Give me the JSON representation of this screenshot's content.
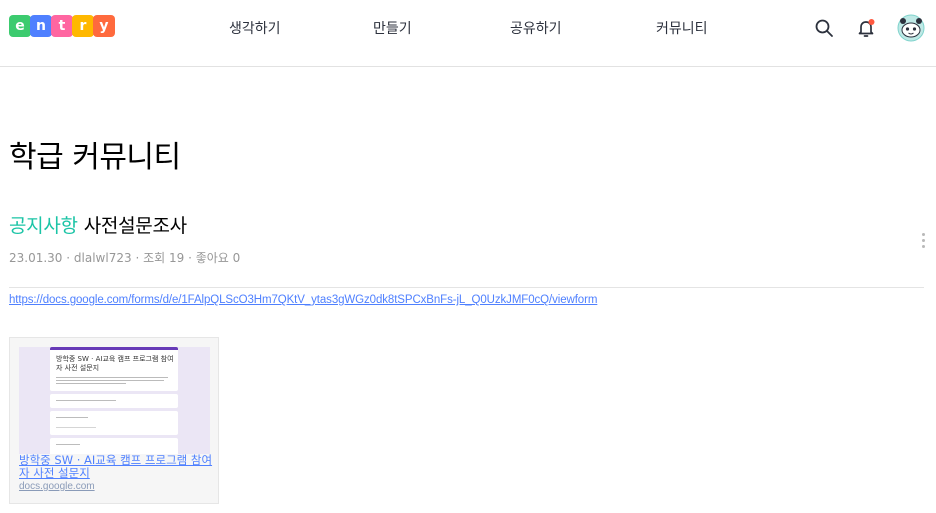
{
  "header": {
    "logo_letters": [
      {
        "char": "e",
        "color": "#3ccb6f"
      },
      {
        "char": "n",
        "color": "#4f80ff"
      },
      {
        "char": "t",
        "color": "#ff66a1"
      },
      {
        "char": "r",
        "color": "#ffb800"
      },
      {
        "char": "y",
        "color": "#ff6a3d"
      }
    ],
    "nav": [
      "생각하기",
      "만들기",
      "공유하기",
      "커뮤니티"
    ],
    "icons": [
      "search-icon",
      "bell-icon",
      "avatar"
    ],
    "notification_dot_color": "#ff5940"
  },
  "page": {
    "title": "학급 커뮤니티"
  },
  "post": {
    "category": "공지사항",
    "title": "사전설문조사",
    "date": "23.01.30",
    "author": "dlalwl723",
    "views": "조회 19",
    "likes": "좋아요 0",
    "link_url": "https://docs.google.com/forms/d/e/1FAlpQLScO3Hm7QKtV_ytas3gWGz0dk8tSPCxBnFs-jL_Q0UzkJMF0cQ/viewform"
  },
  "preview": {
    "form_title": "방학중 SW · AI교육 캠프 프로그램 참여자 사전 설문지",
    "title": "방학중 SW · AI교육 캠프 프로그램 참여자 사전 설문지",
    "domain": "docs.google.com"
  },
  "colors": {
    "accent": "#1bc4a6",
    "link": "#4f80ff",
    "form_purple": "#673ab7"
  }
}
